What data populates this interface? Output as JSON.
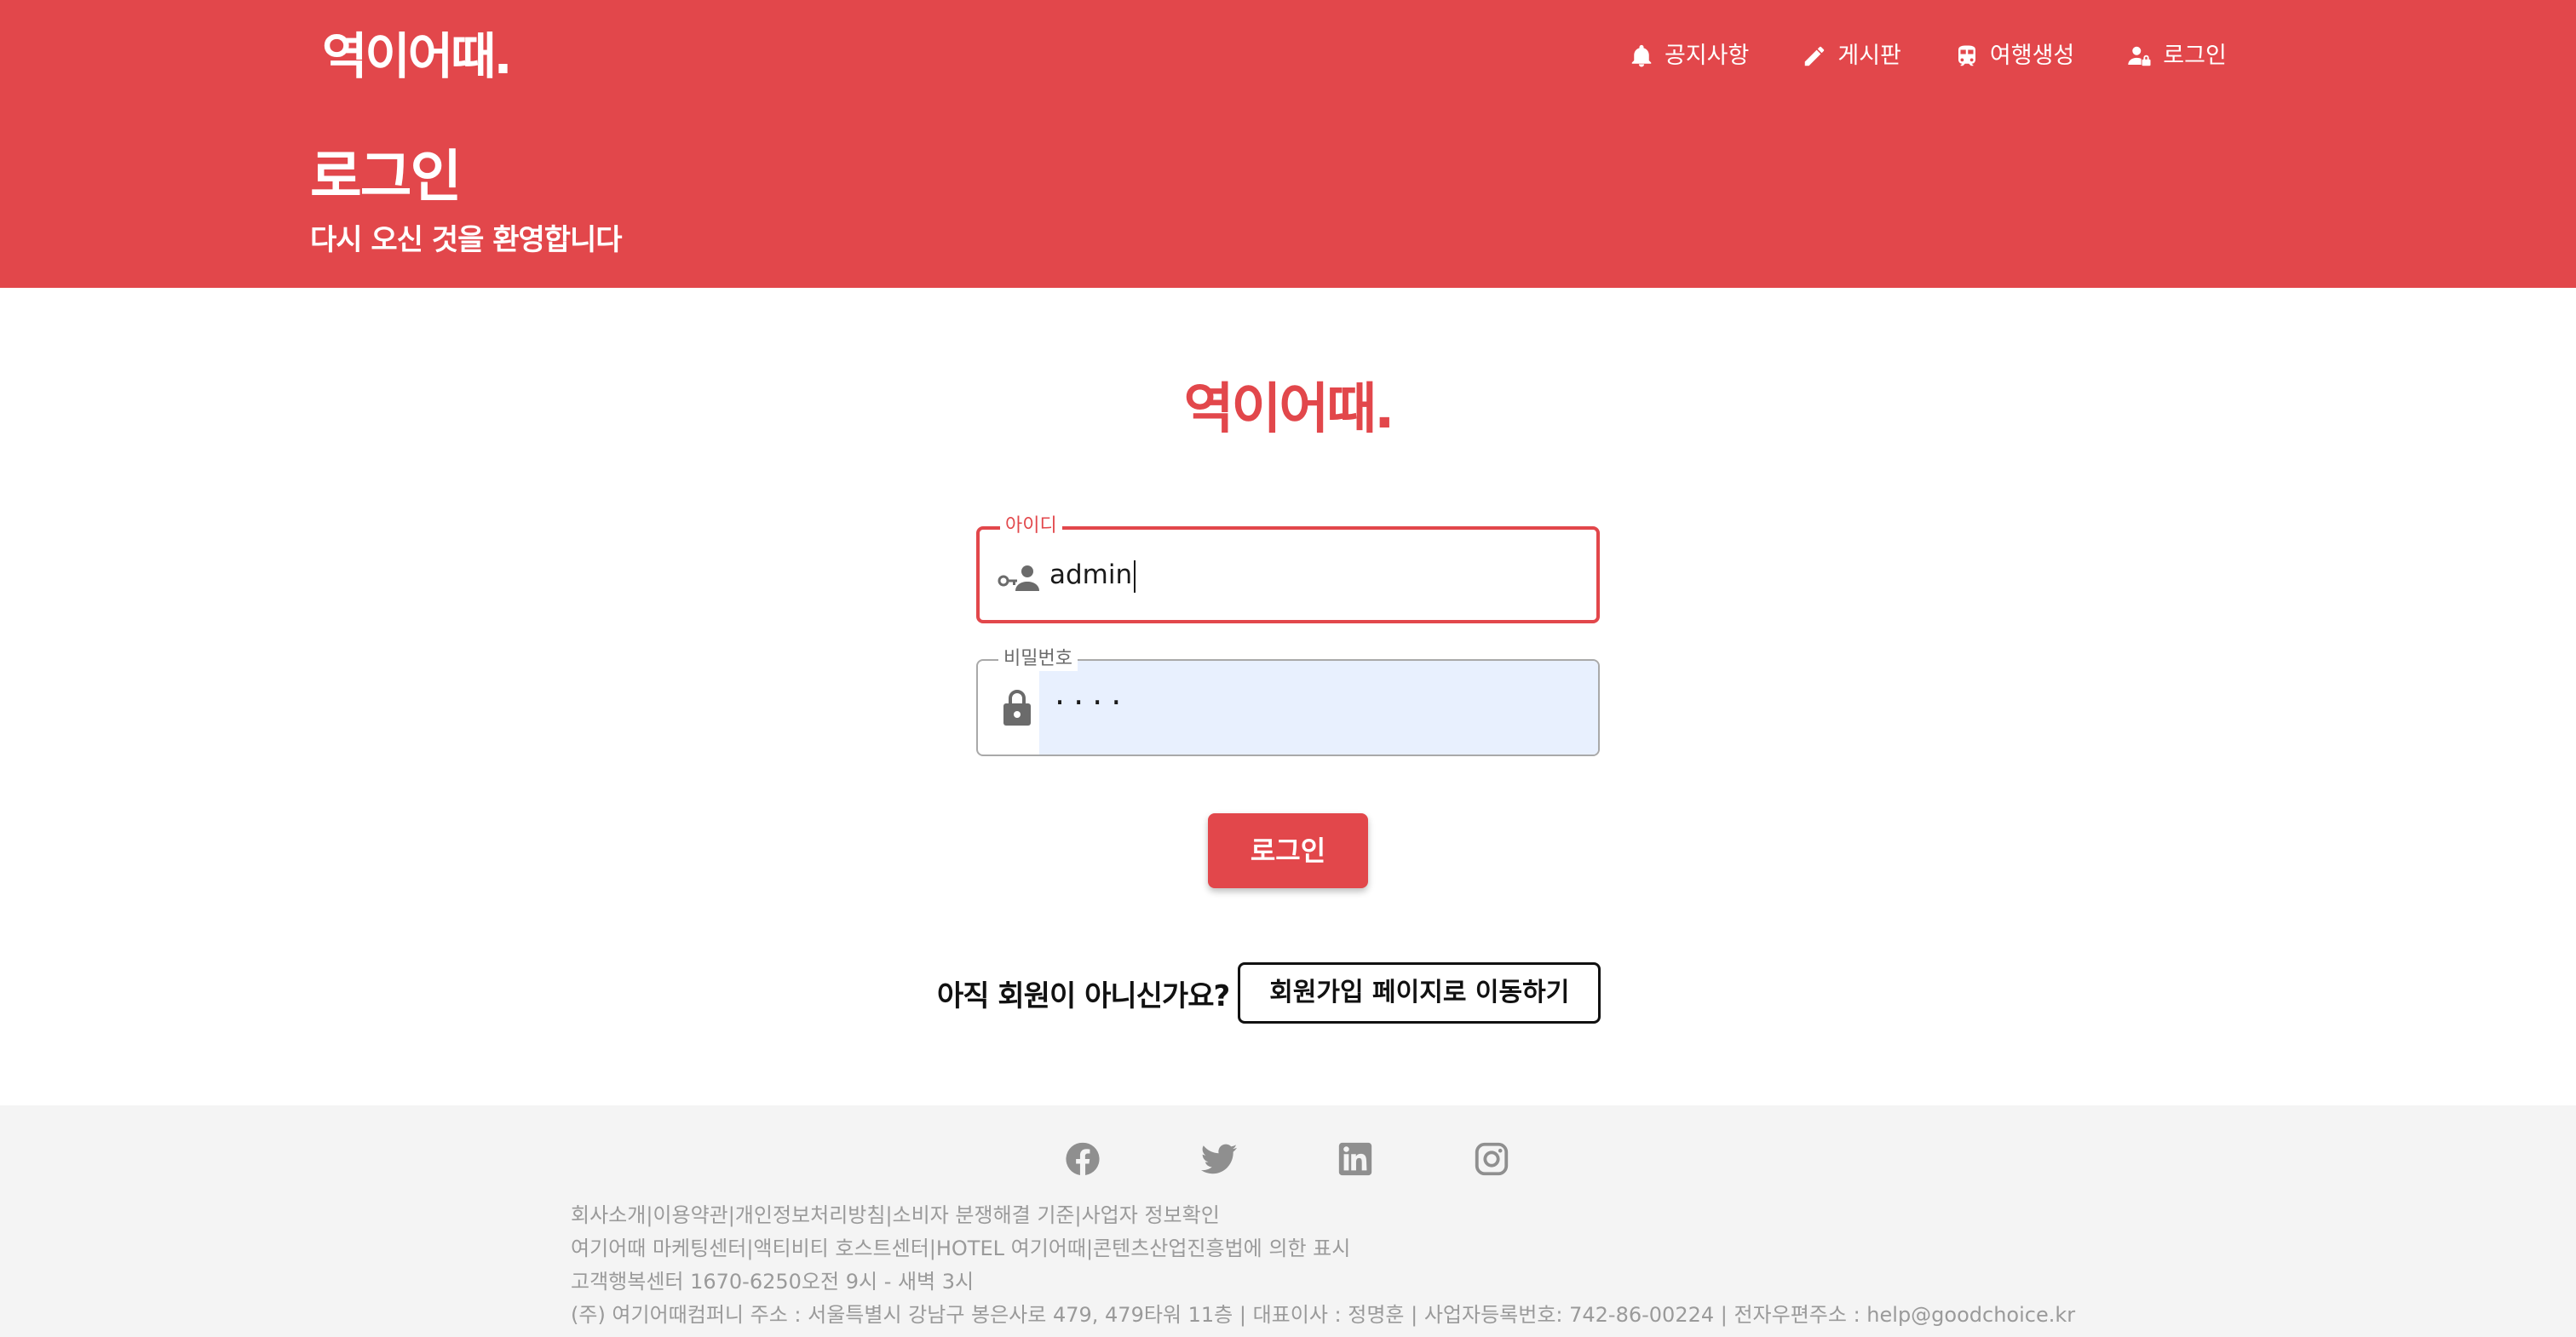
{
  "colors": {
    "brand_red": "#e2474b",
    "autofill_blue": "#e8f0fe",
    "footer_bg": "#f4f4f4"
  },
  "header": {
    "brand": "역이어때.",
    "nav": [
      {
        "label": "공지사항",
        "icon": "bell-icon"
      },
      {
        "label": "게시판",
        "icon": "pencil-icon"
      },
      {
        "label": "여행생성",
        "icon": "train-icon"
      },
      {
        "label": "로그인",
        "icon": "user-lock-icon"
      }
    ],
    "title": "로그인",
    "subtitle": "다시 오신 것을 환영합니다"
  },
  "login": {
    "logo": "역이어때.",
    "id_field": {
      "label": "아이디",
      "value": "admin",
      "icon": "user-key-icon"
    },
    "password_field": {
      "label": "비밀번호",
      "value": "····",
      "icon": "lock-icon"
    },
    "submit_label": "로그인",
    "signup_question": "아직 회원이 아니신가요?",
    "signup_button": "회원가입 페이지로 이동하기"
  },
  "footer": {
    "socials": [
      "facebook-icon",
      "twitter-icon",
      "linkedin-icon",
      "instagram-icon"
    ],
    "lines": [
      "회사소개|이용약관|개인정보처리방침|소비자 분쟁해결 기준|사업자 정보확인",
      "여기어때 마케팅센터|액티비티 호스트센터|HOTEL 여기어때|콘텐츠산업진흥법에 의한 표시",
      "고객행복센터 1670-6250오전 9시 - 새벽 3시",
      "(주) 여기어때컴퍼니 주소 : 서울특별시 강남구 봉은사로 479, 479타워 11층 | 대표이사 : 정명훈 | 사업자등록번호: 742-86-00224 | 전자우편주소 : help@goodchoice.kr"
    ]
  }
}
